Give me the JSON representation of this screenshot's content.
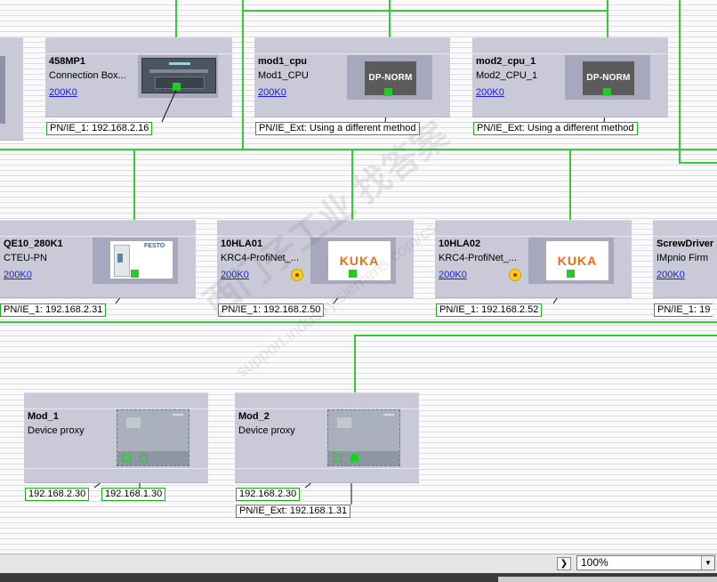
{
  "devices": {
    "mp458": {
      "name": "458MP1",
      "type": "Connection Box...",
      "link": "200K0",
      "address": "PN/IE_1:  192.168.2.16"
    },
    "mod1_cpu": {
      "name": "mod1_cpu",
      "type": "Mod1_CPU",
      "link": "200K0",
      "address": "PN/IE_Ext:  Using a different method",
      "icon_text": "DP-NORM"
    },
    "mod2_cpu_1": {
      "name": "mod2_cpu_1",
      "type": "Mod2_CPU_1",
      "link": "200K0",
      "address": "PN/IE_Ext:  Using a different method",
      "icon_text": "DP-NORM"
    },
    "qe10": {
      "name": "QE10_280K1",
      "type": "CTEU-PN",
      "link": "200K0",
      "address": "PN/IE_1:  192.168.2.31",
      "logo_text": "FESTO"
    },
    "hla01": {
      "name": "10HLA01",
      "type": "KRC4-ProfiNet_...",
      "link": "200K0",
      "address": "PN/IE_1:  192.168.2.50",
      "logo_text": "KUKA"
    },
    "hla02": {
      "name": "10HLA02",
      "type": "KRC4-ProfiNet_...",
      "link": "200K0",
      "address": "PN/IE_1:  192.168.2.52",
      "logo_text": "KUKA"
    },
    "screwdriver": {
      "name": "ScrewDriver",
      "type": "IMpnio  Firm",
      "link": "200K0",
      "address": "PN/IE_1:  19"
    },
    "mod_1": {
      "name": "Mod_1",
      "type": "Device proxy",
      "address_a": "192.168.2.30",
      "address_b": "192.168.1.30"
    },
    "mod_2": {
      "name": "Mod_2",
      "type": "Device proxy",
      "address_a": "192.168.2.30",
      "address_b": "PN/IE_Ext:  192.168.1.31"
    }
  },
  "statusbar": {
    "zoom": "100%",
    "scroll_right_icon": "chevron-right-icon",
    "zoom_dropdown_icon": "triangle-down-icon"
  },
  "watermark": {
    "line1": "西门子工业   找答案",
    "line2": "support.industry.siemens.com/cs"
  },
  "colors": {
    "network": "#33cc33",
    "device_body": "#c9c9d8",
    "icon_well": "#a7a7bd",
    "link": "#1b1bd8",
    "kuka": "#f06a14"
  }
}
